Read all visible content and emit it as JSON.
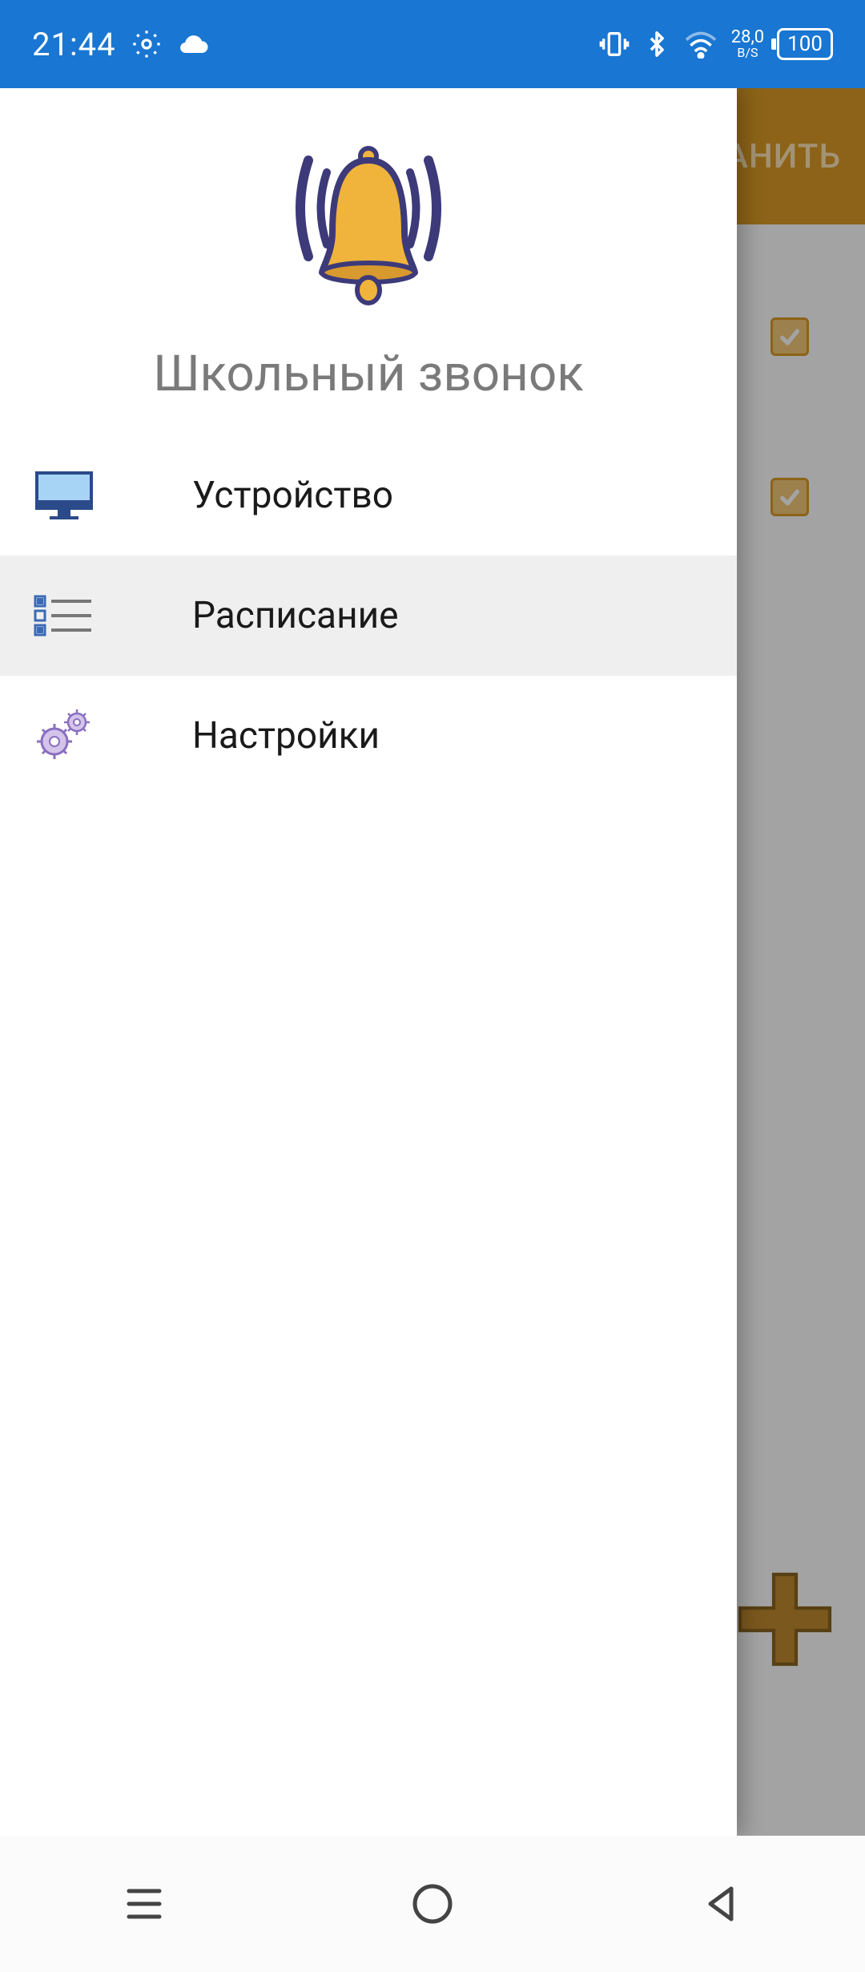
{
  "status": {
    "time": "21:44",
    "net_speed_top": "28,0",
    "net_speed_bottom": "B/S",
    "battery": "100"
  },
  "background": {
    "header_button": "РАНИТЬ"
  },
  "drawer": {
    "title": "Школьный звонок",
    "items": [
      {
        "label": "Устройство",
        "icon": "monitor-icon",
        "selected": false
      },
      {
        "label": "Расписание",
        "icon": "list-icon",
        "selected": true
      },
      {
        "label": "Настройки",
        "icon": "gears-icon",
        "selected": false
      }
    ]
  }
}
